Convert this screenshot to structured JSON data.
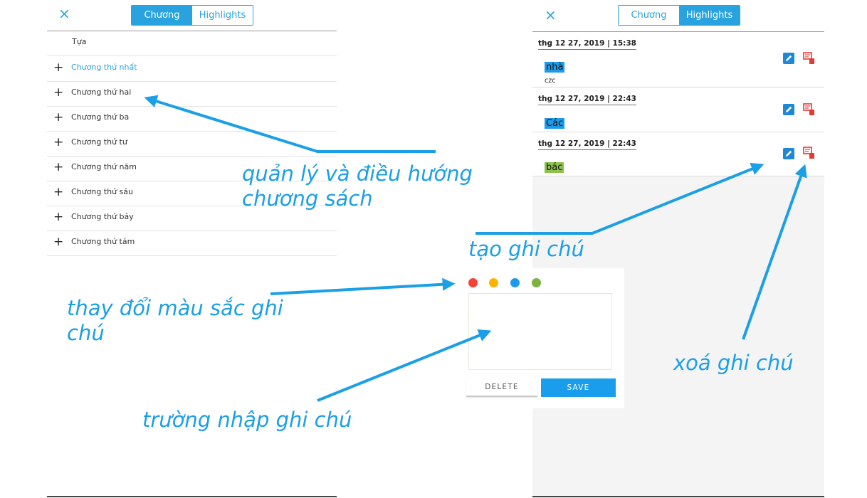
{
  "left_panel": {
    "close_icon": "×",
    "tabs": [
      {
        "label": "Chương",
        "active": true
      },
      {
        "label": "Highlights",
        "active": false
      }
    ],
    "toc_title": "Tựa",
    "chapters": [
      {
        "label": "Chương thứ nhất",
        "active": true
      },
      {
        "label": "Chương thứ hai",
        "active": false
      },
      {
        "label": "Chương thứ ba",
        "active": false
      },
      {
        "label": "Chương thứ tư",
        "active": false
      },
      {
        "label": "Chương thứ năm",
        "active": false
      },
      {
        "label": "Chương thứ sáu",
        "active": false
      },
      {
        "label": "Chương thứ bảy",
        "active": false
      },
      {
        "label": "Chương thứ tám",
        "active": false
      }
    ],
    "plus_icon": "+"
  },
  "right_panel": {
    "close_icon": "×",
    "tabs": [
      {
        "label": "Chương",
        "active": false
      },
      {
        "label": "Highlights",
        "active": true
      }
    ],
    "highlights": [
      {
        "date": "thg 12 27, 2019 | 15:38",
        "text": "nhà",
        "note": "czc",
        "color": "#1e9be8"
      },
      {
        "date": "thg 12 27, 2019 | 22:43",
        "text": "Các",
        "note": "",
        "color": "#1e9be8"
      },
      {
        "date": "thg 12 27, 2019 | 22:43",
        "text": "bác",
        "note": "",
        "color": "#8bc34a"
      }
    ],
    "edit_icon": "pencil-icon",
    "delete_icon": "delete-note-icon"
  },
  "note_editor": {
    "colors": [
      "#f44336",
      "#ffb300",
      "#1e9be8",
      "#7cb342"
    ],
    "input_value": "",
    "delete_label": "DELETE",
    "save_label": "SAVE"
  },
  "annotations": {
    "chapters": [
      "quản lý và điều hướng",
      "chương sách"
    ],
    "create_note": "tạo ghi chú",
    "change_color": [
      "thay đổi màu sắc ghi",
      "chú"
    ],
    "note_field": "trường nhập ghi chú",
    "delete_note": "xoá ghi chú",
    "color": "#1b9fe6"
  }
}
